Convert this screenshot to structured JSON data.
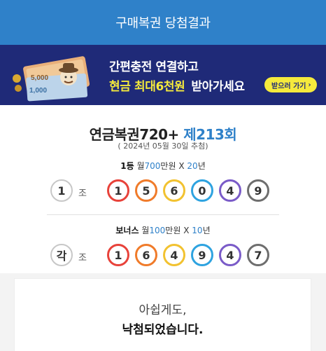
{
  "header": {
    "title": "구매복권 당첨결과"
  },
  "banner": {
    "line1": "간편충전 연결하고",
    "line2_highlight": "현금 최대6천원",
    "line2_rest": "받아가세요",
    "cta_label": "받으러 가기",
    "ticket_text_1": "5,000",
    "ticket_text_2": "1,000",
    "colors": {
      "background": "#1f2a78",
      "highlight": "#f5ea3c"
    }
  },
  "result": {
    "game_name": "연금복권720+",
    "round": "제213회",
    "draw_date": "( 2024년 05월 30일 추첨)",
    "first_prize": {
      "rank": "1등",
      "monthly_prefix": "월",
      "amount": "700",
      "amount_unit": "만원",
      "times": "X",
      "years": "20",
      "years_unit": "년"
    },
    "first_group": "1",
    "jo_label": "조",
    "first_numbers": [
      "1",
      "5",
      "6",
      "0",
      "4",
      "9"
    ],
    "bonus_prize": {
      "rank": "보너스",
      "monthly_prefix": "월",
      "amount": "100",
      "amount_unit": "만원",
      "times": "X",
      "years": "10",
      "years_unit": "년"
    },
    "bonus_group": "각",
    "bonus_numbers": [
      "1",
      "6",
      "4",
      "9",
      "4",
      "7"
    ],
    "ball_colors": [
      "#e8423a",
      "#f07b2a",
      "#f2c230",
      "#2ea3e0",
      "#7a5bc8",
      "#6e6e6e"
    ]
  },
  "message": {
    "sorry": "아쉽게도,",
    "lost": "낙첨되었습니다."
  }
}
